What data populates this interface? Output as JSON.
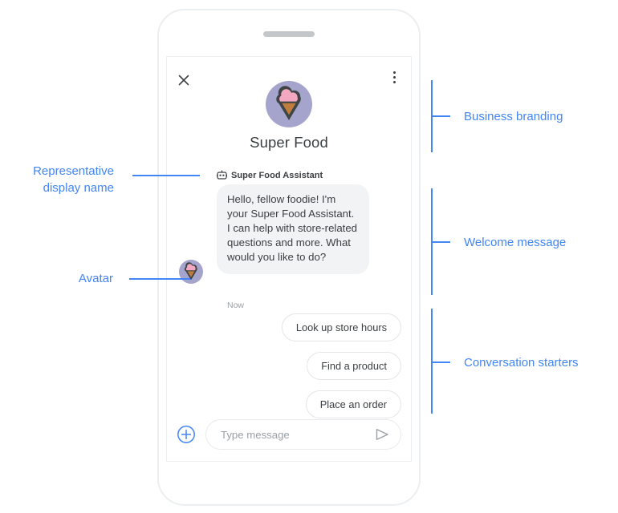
{
  "phone": {
    "speaker_name": "phone-speaker"
  },
  "chat": {
    "header": {
      "close_icon": "close-icon",
      "menu_icon": "more-vertical-icon"
    },
    "branding": {
      "avatar_icon": "ice-cream-cone-avatar",
      "business_name": "Super Food",
      "avatar_colors": {
        "circle": "#a5a4cc",
        "scoop": "#f4a7c0",
        "cone": "#c07e3e",
        "outline": "#3f4544"
      }
    },
    "representative": {
      "bot_icon": "bot-icon",
      "display_name": "Super Food Assistant"
    },
    "message": {
      "avatar_icon": "ice-cream-cone-avatar-small",
      "text": "Hello, fellow foodie! I'm your Super Food Assistant. I can help with store-related questions and more. What would you like to do?",
      "timestamp": "Now"
    },
    "conversation_starters": [
      {
        "label": "Look up store hours"
      },
      {
        "label": "Find a product"
      },
      {
        "label": "Place an order"
      }
    ],
    "composer": {
      "add_icon": "plus-circle-icon",
      "input_value": "",
      "input_placeholder": "Type message",
      "send_icon": "send-icon"
    }
  },
  "annotations": {
    "accent_color": "#4285f4",
    "business_branding": "Business branding",
    "representative_display_name": "Representative\ndisplay name",
    "avatar": "Avatar",
    "welcome_message": "Welcome message",
    "conversation_starters": "Conversation starters"
  }
}
